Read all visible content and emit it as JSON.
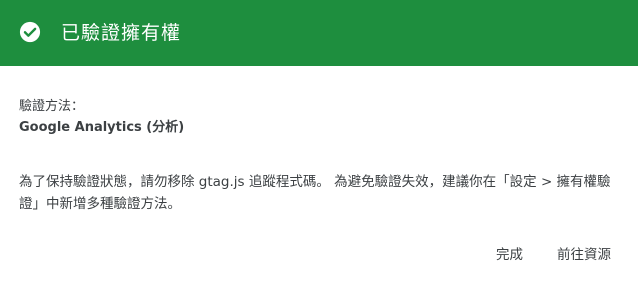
{
  "header": {
    "title": "已驗證擁有權",
    "background_color": "#1e8e3e",
    "icon": "check-circle-icon"
  },
  "verification": {
    "method_label": "驗證方法：",
    "method_value": "Google Analytics (分析)"
  },
  "message": "為了保持驗證狀態，請勿移除 gtag.js 追蹤程式碼。 為避免驗證失效，建議你在「設定 > 擁有權驗證」中新增多種驗證方法。",
  "actions": {
    "done_label": "完成",
    "go_to_property_label": "前往資源"
  }
}
